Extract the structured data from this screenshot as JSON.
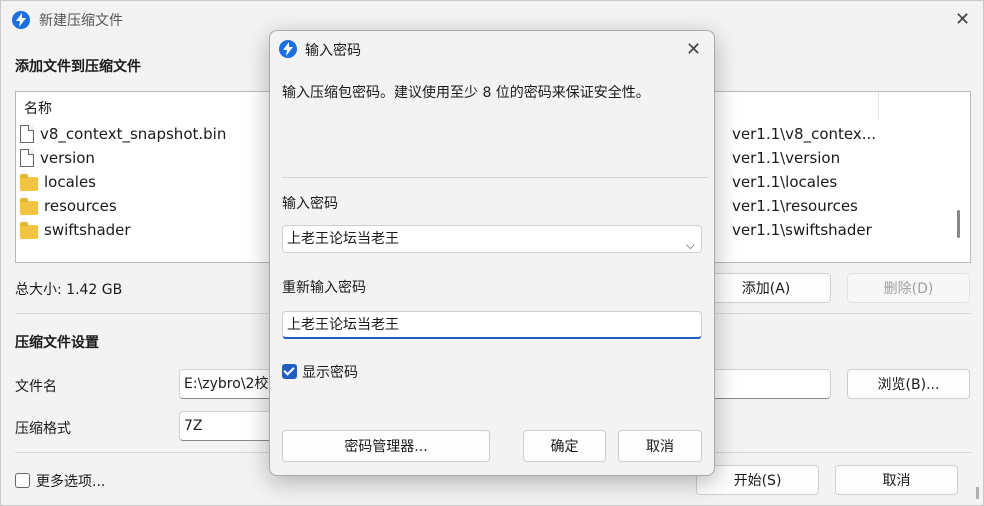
{
  "window": {
    "title": "新建压缩文件",
    "add_section_title": "添加文件到压缩文件",
    "list_header_name": "名称",
    "files": [
      {
        "name": "v8_context_snapshot.bin",
        "type": "file",
        "path": "ver1.1\\v8_contex..."
      },
      {
        "name": "version",
        "type": "file",
        "path": "ver1.1\\version"
      },
      {
        "name": "locales",
        "type": "folder",
        "path": "ver1.1\\locales"
      },
      {
        "name": "resources",
        "type": "folder",
        "path": "ver1.1\\resources"
      },
      {
        "name": "swiftshader",
        "type": "folder",
        "path": "ver1.1\\swiftshader"
      }
    ],
    "total_size": "总大小: 1.42 GB",
    "add_button": "添加(A)",
    "delete_button": "删除(D)",
    "settings_title": "压缩文件设置",
    "filename_label": "文件名",
    "filename_value": "E:\\zybro\\2校",
    "browse_button": "浏览(B)...",
    "format_label": "压缩格式",
    "format_value": "7Z",
    "more_options": "更多选项...",
    "start_button": "开始(S)",
    "cancel_button": "取消"
  },
  "dialog": {
    "title": "输入密码",
    "description": "输入压缩包密码。建议使用至少 8 位的密码来保证安全性。",
    "password_label": "输入密码",
    "password_value": "上老王论坛当老王",
    "reenter_label": "重新输入密码",
    "reenter_value": "上老王论坛当老王",
    "show_password": "显示密码",
    "show_password_checked": true,
    "manager_button": "密码管理器...",
    "ok_button": "确定",
    "cancel_button": "取消"
  },
  "colors": {
    "accent": "#1f5fbf",
    "app_icon": "#1c6fe0",
    "folder": "#f4c542"
  }
}
